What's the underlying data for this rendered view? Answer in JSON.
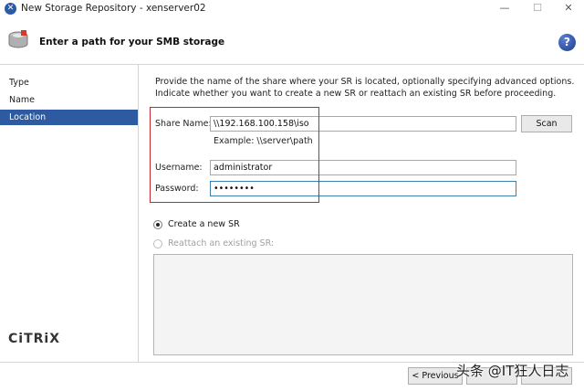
{
  "window": {
    "title": "New Storage Repository - xenserver02"
  },
  "header": {
    "heading": "Enter a path for your SMB storage"
  },
  "sidebar": {
    "steps": [
      {
        "label": "Type"
      },
      {
        "label": "Name"
      },
      {
        "label": "Location"
      }
    ],
    "active_index": 2,
    "brand": "CiTRiX"
  },
  "main": {
    "description": "Provide the name of the share where your SR is located, optionally specifying advanced options. Indicate whether you want to create a new SR or reattach an existing SR before proceeding.",
    "share_name_label": "Share Name:",
    "share_name_value": "\\\\192.168.100.158\\iso",
    "example": "Example: \\\\server\\path",
    "scan_label": "Scan",
    "username_label": "Username:",
    "username_value": "administrator",
    "password_label": "Password:",
    "password_value": "••••••••",
    "radio_create_label": "Create a new SR",
    "radio_reattach_label": "Reattach an existing SR:",
    "selected_option": "create"
  },
  "footer": {
    "previous_label": "< Previous"
  },
  "watermark": "头条 @IT狂人日志",
  "colors": {
    "selection": "#2d5aa0",
    "highlight_box": "#c8262e",
    "focus_border": "#3c7fb1"
  }
}
